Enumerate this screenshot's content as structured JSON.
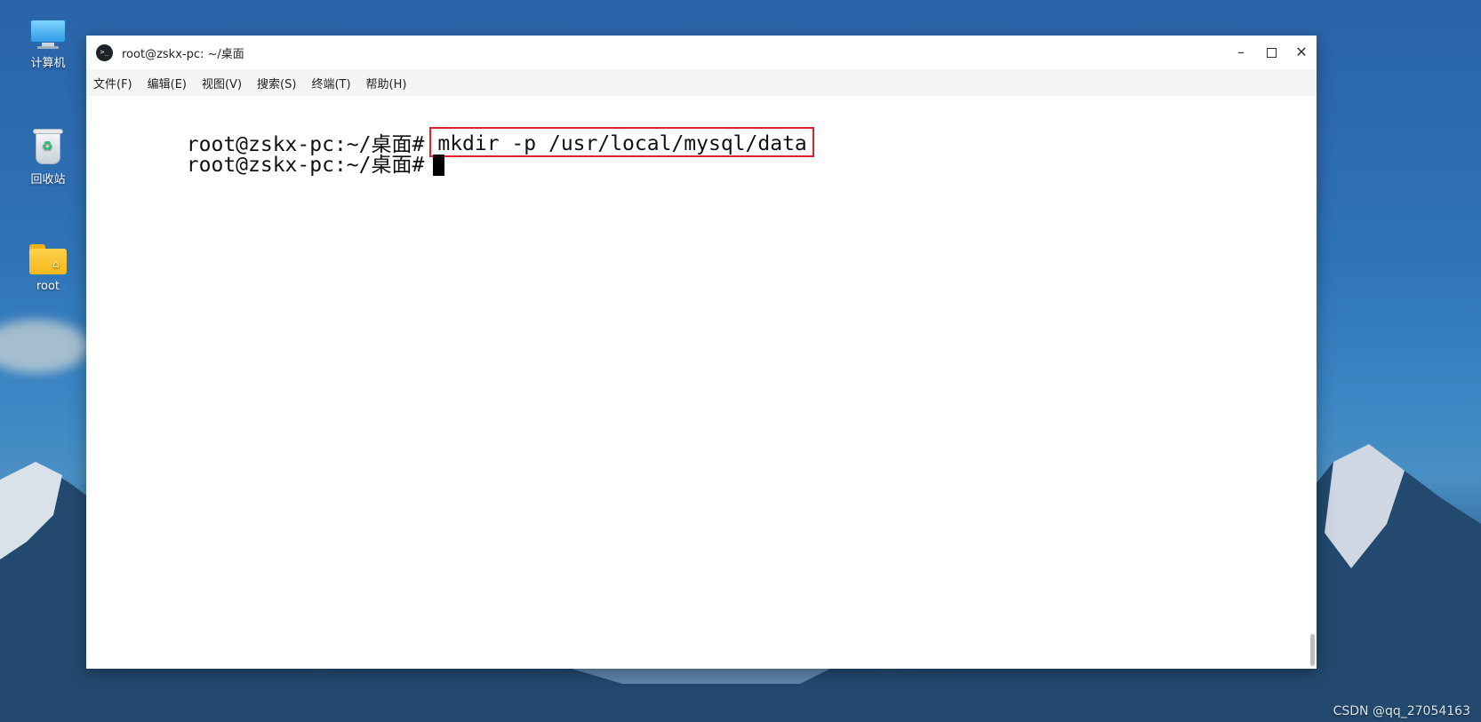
{
  "desktop": {
    "icons": [
      {
        "label": "计算机",
        "icon": "computer-icon"
      },
      {
        "label": "回收站",
        "icon": "trash-bin-icon"
      },
      {
        "label": "root",
        "icon": "home-folder-icon"
      }
    ],
    "watermark": "CSDN @qq_27054163"
  },
  "window": {
    "title": "root@zskx-pc: ~/桌面",
    "controls": [
      "minimize",
      "maximize",
      "close"
    ],
    "menu": [
      "文件(F)",
      "编辑(E)",
      "视图(V)",
      "搜索(S)",
      "终端(T)",
      "帮助(H)"
    ]
  },
  "terminal": {
    "lines": [
      {
        "prompt": "root@zskx-pc:~/桌面#",
        "command": "mkdir -p /usr/local/mysql/data",
        "highlighted": true
      },
      {
        "prompt": "root@zskx-pc:~/桌面#",
        "command": "",
        "cursor": true
      }
    ]
  },
  "colors": {
    "highlight_border": "#e0202a",
    "terminal_bg": "#ffffff",
    "terminal_fg": "#111111"
  }
}
